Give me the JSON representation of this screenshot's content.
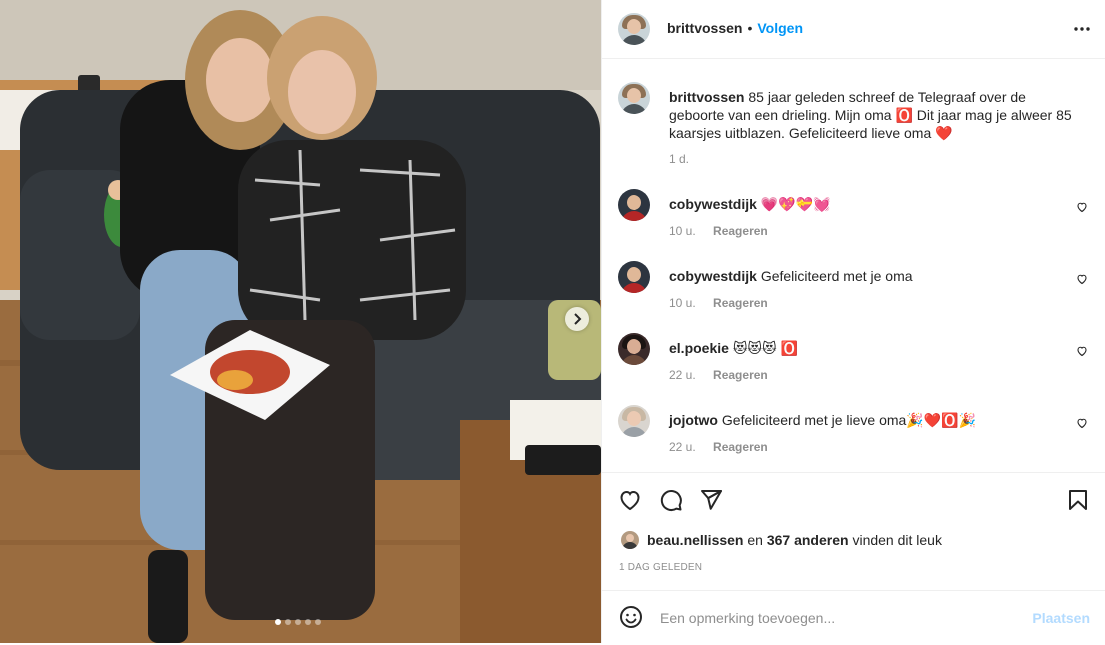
{
  "post": {
    "author": "brittvossen",
    "separator": "•",
    "follow_label": "Volgen",
    "caption": "85 jaar geleden schreef de Telegraaf over de geboorte van een drieling. Mijn oma 🅾️ Dit jaar mag je alweer 85 kaarsjes uitblazen. Gefeliciteerd lieve oma ❤️",
    "caption_time": "1 d."
  },
  "comments": [
    {
      "user": "cobywestdijk",
      "text": "💗💖💝💓",
      "time": "10 u.",
      "reply": "Reageren"
    },
    {
      "user": "cobywestdijk",
      "text": "Gefeliciteerd met je oma",
      "time": "10 u.",
      "reply": "Reageren"
    },
    {
      "user": "el.poekie",
      "text": "😻😻😻 🅾️",
      "time": "22 u.",
      "reply": "Reageren"
    },
    {
      "user": "jojotwo",
      "text": "Gefeliciteerd met je lieve oma🎉❤️🅾️🎉",
      "time": "22 u.",
      "reply": "Reageren"
    }
  ],
  "likes": {
    "user": "beau.nellissen",
    "joiner": " en ",
    "count_text": "367 anderen",
    "suffix": " vinden dit leuk"
  },
  "date_label": "1 DAG GELEDEN",
  "add_comment": {
    "placeholder": "Een opmerking toevoegen...",
    "post_label": "Plaatsen"
  },
  "carousel": {
    "slides": 5,
    "active": 0
  },
  "icons": {
    "more": "more-horizontal-icon",
    "like": "heart-icon",
    "comment": "comment-bubble-icon",
    "share": "paper-plane-icon",
    "save": "bookmark-icon",
    "emoji": "smiley-icon",
    "next": "chevron-right-icon"
  },
  "colors": {
    "accent": "#0095f6",
    "post_disabled": "#b3dbff",
    "muted": "#8e8e8e",
    "text": "#262626",
    "border": "#efefef"
  }
}
